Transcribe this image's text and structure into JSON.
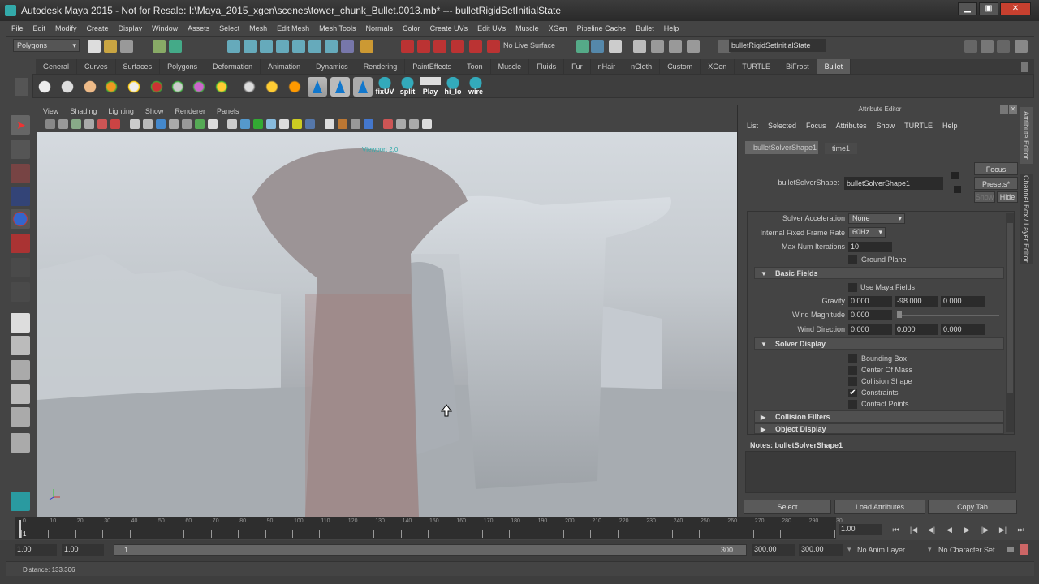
{
  "window": {
    "title": "Autodesk Maya 2015 - Not for Resale: I:\\Maya_2015_xgen\\scenes\\tower_chunk_Bullet.0013.mb*   ---   bulletRigidSetInitialState",
    "minimize": "▁",
    "maximize": "▣",
    "close": "✕"
  },
  "menubar": [
    "File",
    "Edit",
    "Modify",
    "Create",
    "Display",
    "Window",
    "Assets",
    "Select",
    "Mesh",
    "Edit Mesh",
    "Mesh Tools",
    "Normals",
    "Color",
    "Create UVs",
    "Edit UVs",
    "Muscle",
    "XGen",
    "Pipeline Cache",
    "Bullet",
    "Help"
  ],
  "statusline": {
    "menuset": "Polygons",
    "live_surface": "No Live Surface",
    "selection_field": "bulletRigidSetInitialState"
  },
  "shelf_tabs": [
    "General",
    "Curves",
    "Surfaces",
    "Polygons",
    "Deformation",
    "Animation",
    "Dynamics",
    "Rendering",
    "PaintEffects",
    "Toon",
    "Muscle",
    "Fluids",
    "Fur",
    "nHair",
    "nCloth",
    "Custom",
    "XGen",
    "TURTLE",
    "BiFrost",
    "Bullet"
  ],
  "shelf_active": "Bullet",
  "shelf_labels": [
    "fixUV",
    "split",
    "Play",
    "hi_lo",
    "wire"
  ],
  "viewport": {
    "menu": [
      "View",
      "Shading",
      "Lighting",
      "Show",
      "Renderer",
      "Panels"
    ],
    "renderer_label": "Viewport 2.0"
  },
  "attribute_editor": {
    "title": "Attribute Editor",
    "menu": [
      "List",
      "Selected",
      "Focus",
      "Attributes",
      "Show",
      "TURTLE",
      "Help"
    ],
    "tabs": [
      "bulletSolverShape1",
      "time1"
    ],
    "node_label": "bulletSolverShape:",
    "node_value": "bulletSolverShape1",
    "focus": "Focus",
    "presets": "Presets*",
    "show": "Show",
    "hide": "Hide",
    "solver_acceleration": {
      "label": "Solver Acceleration",
      "value": "None"
    },
    "frame_rate": {
      "label": "Internal Fixed Frame Rate",
      "value": "60Hz"
    },
    "max_iterations": {
      "label": "Max Num Iterations",
      "value": "10"
    },
    "ground_plane": {
      "label": "Ground Plane",
      "checked": false
    },
    "basic_fields": {
      "title": "Basic Fields",
      "use_maya_fields": "Use Maya Fields",
      "gravity_label": "Gravity",
      "gravity": [
        "0.000",
        "-98.000",
        "0.000"
      ],
      "wind_mag_label": "Wind Magnitude",
      "wind_mag": "0.000",
      "wind_dir_label": "Wind Direction",
      "wind_dir": [
        "0.000",
        "0.000",
        "0.000"
      ]
    },
    "solver_display": {
      "title": "Solver Display",
      "items": [
        {
          "label": "Bounding Box",
          "checked": false
        },
        {
          "label": "Center Of Mass",
          "checked": false
        },
        {
          "label": "Collision Shape",
          "checked": false
        },
        {
          "label": "Constraints",
          "checked": true
        },
        {
          "label": "Contact Points",
          "checked": false
        }
      ]
    },
    "collapsed": [
      "Collision Filters",
      "Object Display"
    ],
    "notes": "Notes:  bulletSolverShape1",
    "buttons": [
      "Select",
      "Load Attributes",
      "Copy Tab"
    ],
    "side_tabs": [
      "Attribute Editor",
      "Channel Box / Layer Editor"
    ],
    "check": "✔"
  },
  "timeline": {
    "ticks": [
      "0",
      "10",
      "20",
      "30",
      "40",
      "50",
      "60",
      "70",
      "80",
      "90",
      "100",
      "110",
      "120",
      "130",
      "140",
      "150",
      "160",
      "170",
      "180",
      "190",
      "200",
      "210",
      "220",
      "230",
      "240",
      "250",
      "260",
      "270",
      "280",
      "290",
      "30"
    ],
    "current_frame": "1.00",
    "current_marker": "1"
  },
  "range": {
    "start": "1.00",
    "anim_start": "1.00",
    "slider_start": "1",
    "slider_end": "300",
    "anim_end": "300.00",
    "end": "300.00",
    "anim_layer": "No Anim Layer",
    "character_set": "No Character Set"
  },
  "helpline": "Distance:  133.306",
  "playback": [
    "⏮",
    "|◀",
    "◀|",
    "◀",
    "▶",
    "|▶",
    "▶|",
    "⏭"
  ]
}
